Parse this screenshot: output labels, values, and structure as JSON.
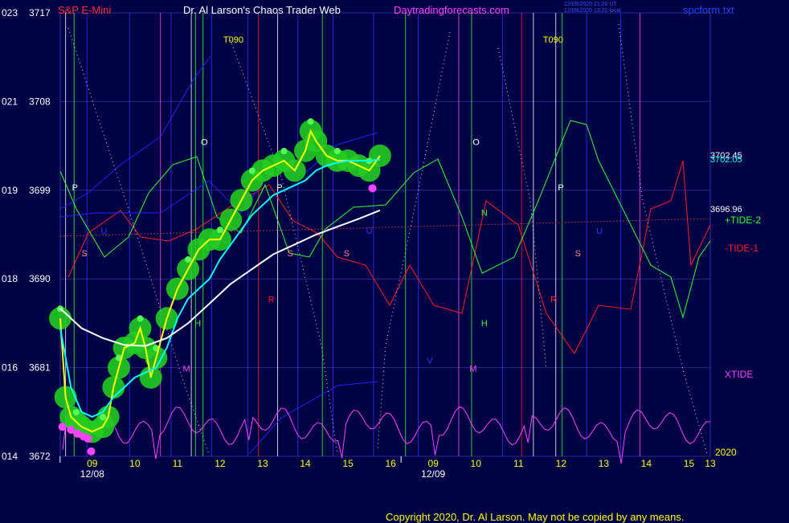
{
  "header": {
    "instrument": "S&P E-Mini",
    "site_title": "Dr. Al Larson's Chaos Trader Web",
    "url": "Daytradingforecasts.com",
    "file": "spcform.txt"
  },
  "copyright": "Copyright 2020, Dr. Al Larson. May not be copied by any means.",
  "colors": {
    "background": "#000044",
    "price_line": "#ffff00",
    "ema_fast": "#00ffff",
    "ema_slow": "#ffffff",
    "xtide": "#ff44ff",
    "tide1": "#ff2020",
    "tide2": "#33ff33",
    "blue_line": "#2222ff",
    "glow": "#22cc22"
  },
  "chart_data": {
    "type": "line",
    "title": "S&P E-Mini",
    "ylim": [
      3672,
      3717
    ],
    "y_ticks": [
      {
        "value": 3717,
        "left": "023",
        "right": "3717"
      },
      {
        "value": 3708,
        "left": "021",
        "right": "3708"
      },
      {
        "value": 3699,
        "left": "019",
        "right": "3699"
      },
      {
        "value": 3690,
        "left": "018",
        "right": "3690"
      },
      {
        "value": 3681,
        "left": "016",
        "right": "3681"
      },
      {
        "value": 3672,
        "left": "014",
        "right": "3672"
      }
    ],
    "x_range": [
      0,
      61
    ],
    "x_ticks": [
      {
        "x": 3,
        "label": "09"
      },
      {
        "x": 7,
        "label": "10"
      },
      {
        "x": 11,
        "label": "11"
      },
      {
        "x": 15,
        "label": "12"
      },
      {
        "x": 19,
        "label": "13"
      },
      {
        "x": 23,
        "label": "14"
      },
      {
        "x": 27,
        "label": "15"
      },
      {
        "x": 31,
        "label": "16"
      },
      {
        "x": 35,
        "label": "09"
      },
      {
        "x": 39,
        "label": "10"
      },
      {
        "x": 43,
        "label": "11"
      },
      {
        "x": 47,
        "label": "12"
      },
      {
        "x": 51,
        "label": "13"
      },
      {
        "x": 55,
        "label": "14"
      },
      {
        "x": 59,
        "label": "15"
      },
      {
        "x": 61,
        "label": "13"
      }
    ],
    "date_labels": [
      {
        "x": 3,
        "label": "12/08"
      },
      {
        "x": 35,
        "label": "12/09"
      }
    ],
    "year_label": "2020",
    "price_labels": [
      "3702.45",
      "3702.05",
      "3696.96"
    ],
    "legend": [
      "+TIDE-2",
      "-TIDE-1",
      "XTIDE"
    ],
    "series": [
      {
        "name": "S&P E-Mini",
        "color": "#ffff00",
        "x": [
          0,
          0.5,
          1,
          1.5,
          2,
          3,
          4,
          4.5,
          5,
          5.5,
          6,
          7,
          7.5,
          8,
          8.5,
          9,
          10,
          11,
          12,
          13,
          14,
          15,
          16,
          17,
          18,
          19,
          20,
          21,
          22,
          23,
          23.5,
          24,
          25,
          26,
          27,
          28,
          29,
          30
        ],
        "values": [
          3686,
          3678,
          3676,
          3675.5,
          3675,
          3674.5,
          3675,
          3676,
          3679,
          3681,
          3683,
          3683.5,
          3685,
          3683,
          3680,
          3682,
          3686,
          3689,
          3691,
          3693,
          3694,
          3694,
          3696,
          3698,
          3700,
          3701,
          3701.5,
          3702,
          3701,
          3703,
          3705,
          3704,
          3702.5,
          3702,
          3702,
          3701.5,
          3701,
          3702.5
        ]
      },
      {
        "name": "EMA fast",
        "color": "#00ffff",
        "x": [
          0,
          1,
          2,
          3,
          4,
          5,
          6,
          7,
          8,
          9,
          10,
          11,
          12,
          13,
          14,
          15,
          16,
          17,
          18,
          19,
          20,
          21,
          22,
          23,
          24,
          25,
          26,
          27,
          28,
          29,
          30
        ],
        "values": [
          3685,
          3679,
          3676.5,
          3676,
          3676.5,
          3678,
          3679,
          3680,
          3680.5,
          3681,
          3683,
          3686,
          3688,
          3689,
          3690,
          3692,
          3693.5,
          3695,
          3696.5,
          3697.5,
          3698.5,
          3699,
          3699.5,
          3700,
          3701,
          3701.5,
          3701.8,
          3702,
          3702,
          3702,
          3702.1
        ]
      },
      {
        "name": "EMA slow",
        "color": "#ffffff",
        "x": [
          0,
          2,
          4,
          6,
          8,
          10,
          12,
          14,
          16,
          18,
          20,
          22,
          24,
          26,
          28,
          30
        ],
        "values": [
          3687,
          3685,
          3684,
          3683.3,
          3683.2,
          3684,
          3685.5,
          3687.5,
          3689.5,
          3691,
          3692.5,
          3693.5,
          3694.5,
          3695.3,
          3696.1,
          3696.96
        ]
      }
    ]
  },
  "cycle_labels": [
    {
      "text": "T090",
      "x": 15.3,
      "y": 3714,
      "color": "#ffff00"
    },
    {
      "text": "T090",
      "x": 45.3,
      "y": 3714,
      "color": "#ffff00"
    },
    {
      "text": "O",
      "x": 13.2,
      "y": 3703.6,
      "color": "#ffffff"
    },
    {
      "text": "O",
      "x": 38.7,
      "y": 3703.6,
      "color": "#ffffff"
    },
    {
      "text": "P",
      "x": 1.1,
      "y": 3699,
      "color": "#ffffff"
    },
    {
      "text": "P",
      "x": 20.3,
      "y": 3699,
      "color": "#ffffff"
    },
    {
      "text": "P",
      "x": 46.7,
      "y": 3699,
      "color": "#ffffff"
    },
    {
      "text": "N",
      "x": 39.5,
      "y": 3696.4,
      "color": "#33ff33"
    },
    {
      "text": "U",
      "x": 3.8,
      "y": 3694.6,
      "color": "#3333ff"
    },
    {
      "text": "U",
      "x": 28.7,
      "y": 3694.6,
      "color": "#3333ff"
    },
    {
      "text": "U",
      "x": 50.3,
      "y": 3694.6,
      "color": "#3333ff"
    },
    {
      "text": "S",
      "x": 2.0,
      "y": 3692.3,
      "color": "#ff8888"
    },
    {
      "text": "S",
      "x": 21.3,
      "y": 3692.3,
      "color": "#ff8888"
    },
    {
      "text": "S",
      "x": 26.6,
      "y": 3692.3,
      "color": "#ff8888"
    },
    {
      "text": "S",
      "x": 48.3,
      "y": 3692.3,
      "color": "#ff8888"
    },
    {
      "text": "R",
      "x": 19.5,
      "y": 3687.6,
      "color": "#ff2020"
    },
    {
      "text": "R",
      "x": 46.0,
      "y": 3687.6,
      "color": "#ff2020"
    },
    {
      "text": "H",
      "x": 12.6,
      "y": 3685.2,
      "color": "#33ff33"
    },
    {
      "text": "H",
      "x": 39.5,
      "y": 3685.2,
      "color": "#33ff33"
    },
    {
      "text": "V",
      "x": 34.4,
      "y": 3681.4,
      "color": "#3333ff"
    },
    {
      "text": "M",
      "x": 11.5,
      "y": 3680.6,
      "color": "#ff44ff"
    },
    {
      "text": "M",
      "x": 38.4,
      "y": 3680.6,
      "color": "#ff44ff"
    }
  ],
  "dates": [
    "12/08",
    "12/09"
  ],
  "stamp": [
    "12/09/2020 21:20 UT",
    "12/09/2020 13:20 local"
  ]
}
